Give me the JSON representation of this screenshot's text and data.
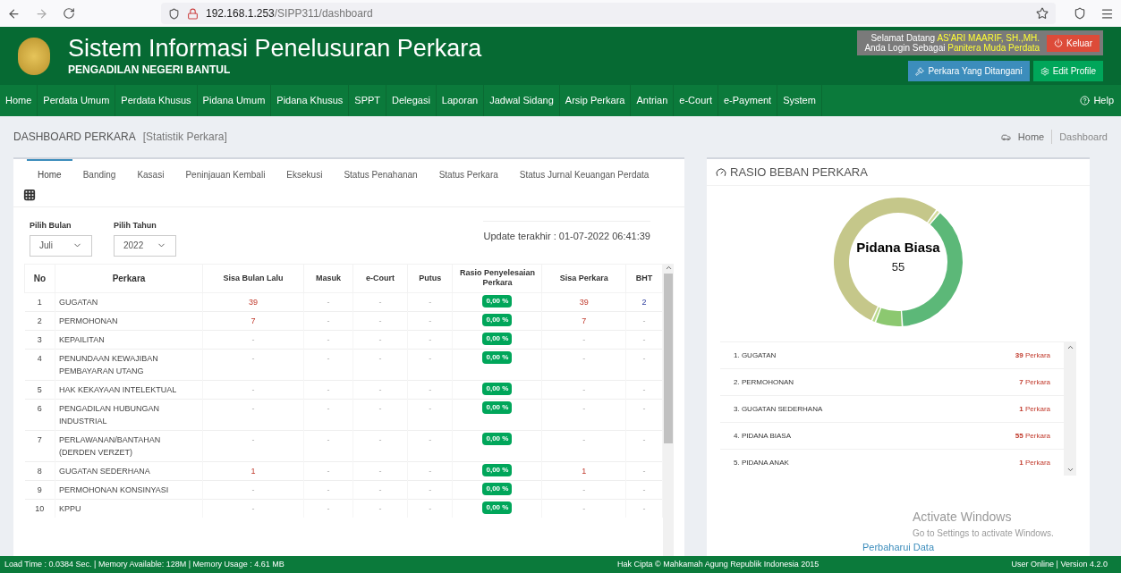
{
  "browser": {
    "url_host": "192.168.1.253",
    "url_path": "/SIPP311/dashboard"
  },
  "header": {
    "title": "Sistem Informasi Penelusuran Perkara",
    "subtitle": "PENGADILAN NEGERI BANTUL",
    "greeting": "Selamat Datang",
    "user": "AS'ARI MAARIF, SH.,MH.",
    "login_as": "Anda Login Sebagai",
    "role": "Panitera Muda Perdata",
    "logout": "Keluar",
    "cases_button": "Perkara Yang Ditangani",
    "profile_button": "Edit Profile"
  },
  "nav": {
    "items": [
      "Home",
      "Perdata Umum",
      "Perdata Khusus",
      "Pidana Umum",
      "Pidana Khusus",
      "SPPT",
      "Delegasi",
      "Laporan",
      "Jadwal Sidang",
      "Arsip Perkara",
      "Antrian",
      "e-Court",
      "e-Payment",
      "System"
    ],
    "help": "Help"
  },
  "page": {
    "title": "DASHBOARD PERKARA",
    "subtitle": "[Statistik Perkara]",
    "breadcrumb": [
      "Home",
      "Dashboard"
    ]
  },
  "tabs": [
    {
      "label": "Home",
      "selected": true
    },
    {
      "label": "Banding",
      "selected": false
    },
    {
      "label": "Kasasi",
      "selected": false
    },
    {
      "label": "Peninjauan Kembali",
      "selected": false
    },
    {
      "label": "Eksekusi",
      "selected": false
    },
    {
      "label": "Status Penahanan",
      "selected": false
    },
    {
      "label": "Status Perkara",
      "selected": false
    },
    {
      "label": "Status Jurnal Keuangan Perdata",
      "selected": false
    }
  ],
  "filters": [
    {
      "label": "Pilih Bulan",
      "value": "Juli"
    },
    {
      "label": "Pilih Tahun",
      "value": "2022"
    }
  ],
  "update": "Update terakhir : 01-07-2022 06:41:39",
  "table": {
    "columns": [
      {
        "label": "No",
        "kind": "no"
      },
      {
        "label": "Perkara",
        "kind": "text"
      },
      {
        "label": "Sisa Bulan Lalu",
        "kind": "count"
      },
      {
        "label": "Masuk",
        "kind": "number"
      },
      {
        "label": "e-Court",
        "kind": "number"
      },
      {
        "label": "Putus",
        "kind": "number"
      },
      {
        "label": "Rasio Penyelesaian Perkara",
        "kind": "badge"
      },
      {
        "label": "Sisa Perkara",
        "kind": "count"
      },
      {
        "label": "BHT",
        "kind": "verdict"
      }
    ],
    "rows": [
      [
        "1",
        "GUGATAN",
        "39",
        "-",
        "-",
        "-",
        "0,00 %",
        "39",
        "2"
      ],
      [
        "2",
        "PERMOHONAN",
        "7",
        "-",
        "-",
        "-",
        "0,00 %",
        "7",
        "-"
      ],
      [
        "3",
        "KEPAILITAN",
        "-",
        "-",
        "-",
        "-",
        "0,00 %",
        "-",
        "-"
      ],
      [
        "4",
        "PENUNDAAN KEWAJIBAN PEMBAYARAN UTANG",
        "-",
        "-",
        "-",
        "-",
        "0,00 %",
        "-",
        "-"
      ],
      [
        "5",
        "HAK KEKAYAAN INTELEKTUAL",
        "-",
        "-",
        "-",
        "-",
        "0,00 %",
        "-",
        "-"
      ],
      [
        "6",
        "PENGADILAN HUBUNGAN INDUSTRIAL",
        "-",
        "-",
        "-",
        "-",
        "0,00 %",
        "-",
        "-"
      ],
      [
        "7",
        "PERLAWANAN/BANTAHAN (DERDEN VERZET)",
        "-",
        "-",
        "-",
        "-",
        "0,00 %",
        "-",
        "-"
      ],
      [
        "8",
        "GUGATAN SEDERHANA",
        "1",
        "-",
        "-",
        "-",
        "0,00 %",
        "1",
        "-"
      ],
      [
        "9",
        "PERMOHONAN KONSINYASI",
        "-",
        "-",
        "-",
        "-",
        "0,00 %",
        "-",
        "-"
      ],
      [
        "10",
        "KPPU",
        "-",
        "-",
        "-",
        "-",
        "0,00 %",
        "-",
        "-"
      ]
    ]
  },
  "ratio_panel": {
    "title": "RASIO BEBAN PERKARA",
    "center_label": "Pidana Biasa",
    "center_value": "55",
    "items": [
      {
        "label": "1. GUGATAN",
        "count": "**39** Perkara",
        "color": "#5cb878"
      },
      {
        "label": "2. PERMOHONAN",
        "count": "**7** Perkara",
        "color": "#8cc870"
      },
      {
        "label": "3. GUGATAN SEDERHANA",
        "count": "**1** Perkara",
        "color": "#b9d98a"
      },
      {
        "label": "4. PIDANA BIASA",
        "count": "**55** Perkara",
        "color": "#c5c78a"
      },
      {
        "label": "5. PIDANA ANAK",
        "count": "**1** Perkara",
        "color": "#d3dc9c"
      }
    ],
    "refresh": "Perbaharui Data"
  },
  "os_notice": {
    "title": "Activate Windows",
    "text": "Go to Settings to activate Windows."
  },
  "footer": {
    "left": "Load Time : 0.0384 Sec. | Memory Available: 128M | Memory Usage : 4.61 MB",
    "center": "Hak Cipta © Mahkamah Agung Republik Indonesia 2015",
    "right": "User Online | Version 4.2.0"
  }
}
